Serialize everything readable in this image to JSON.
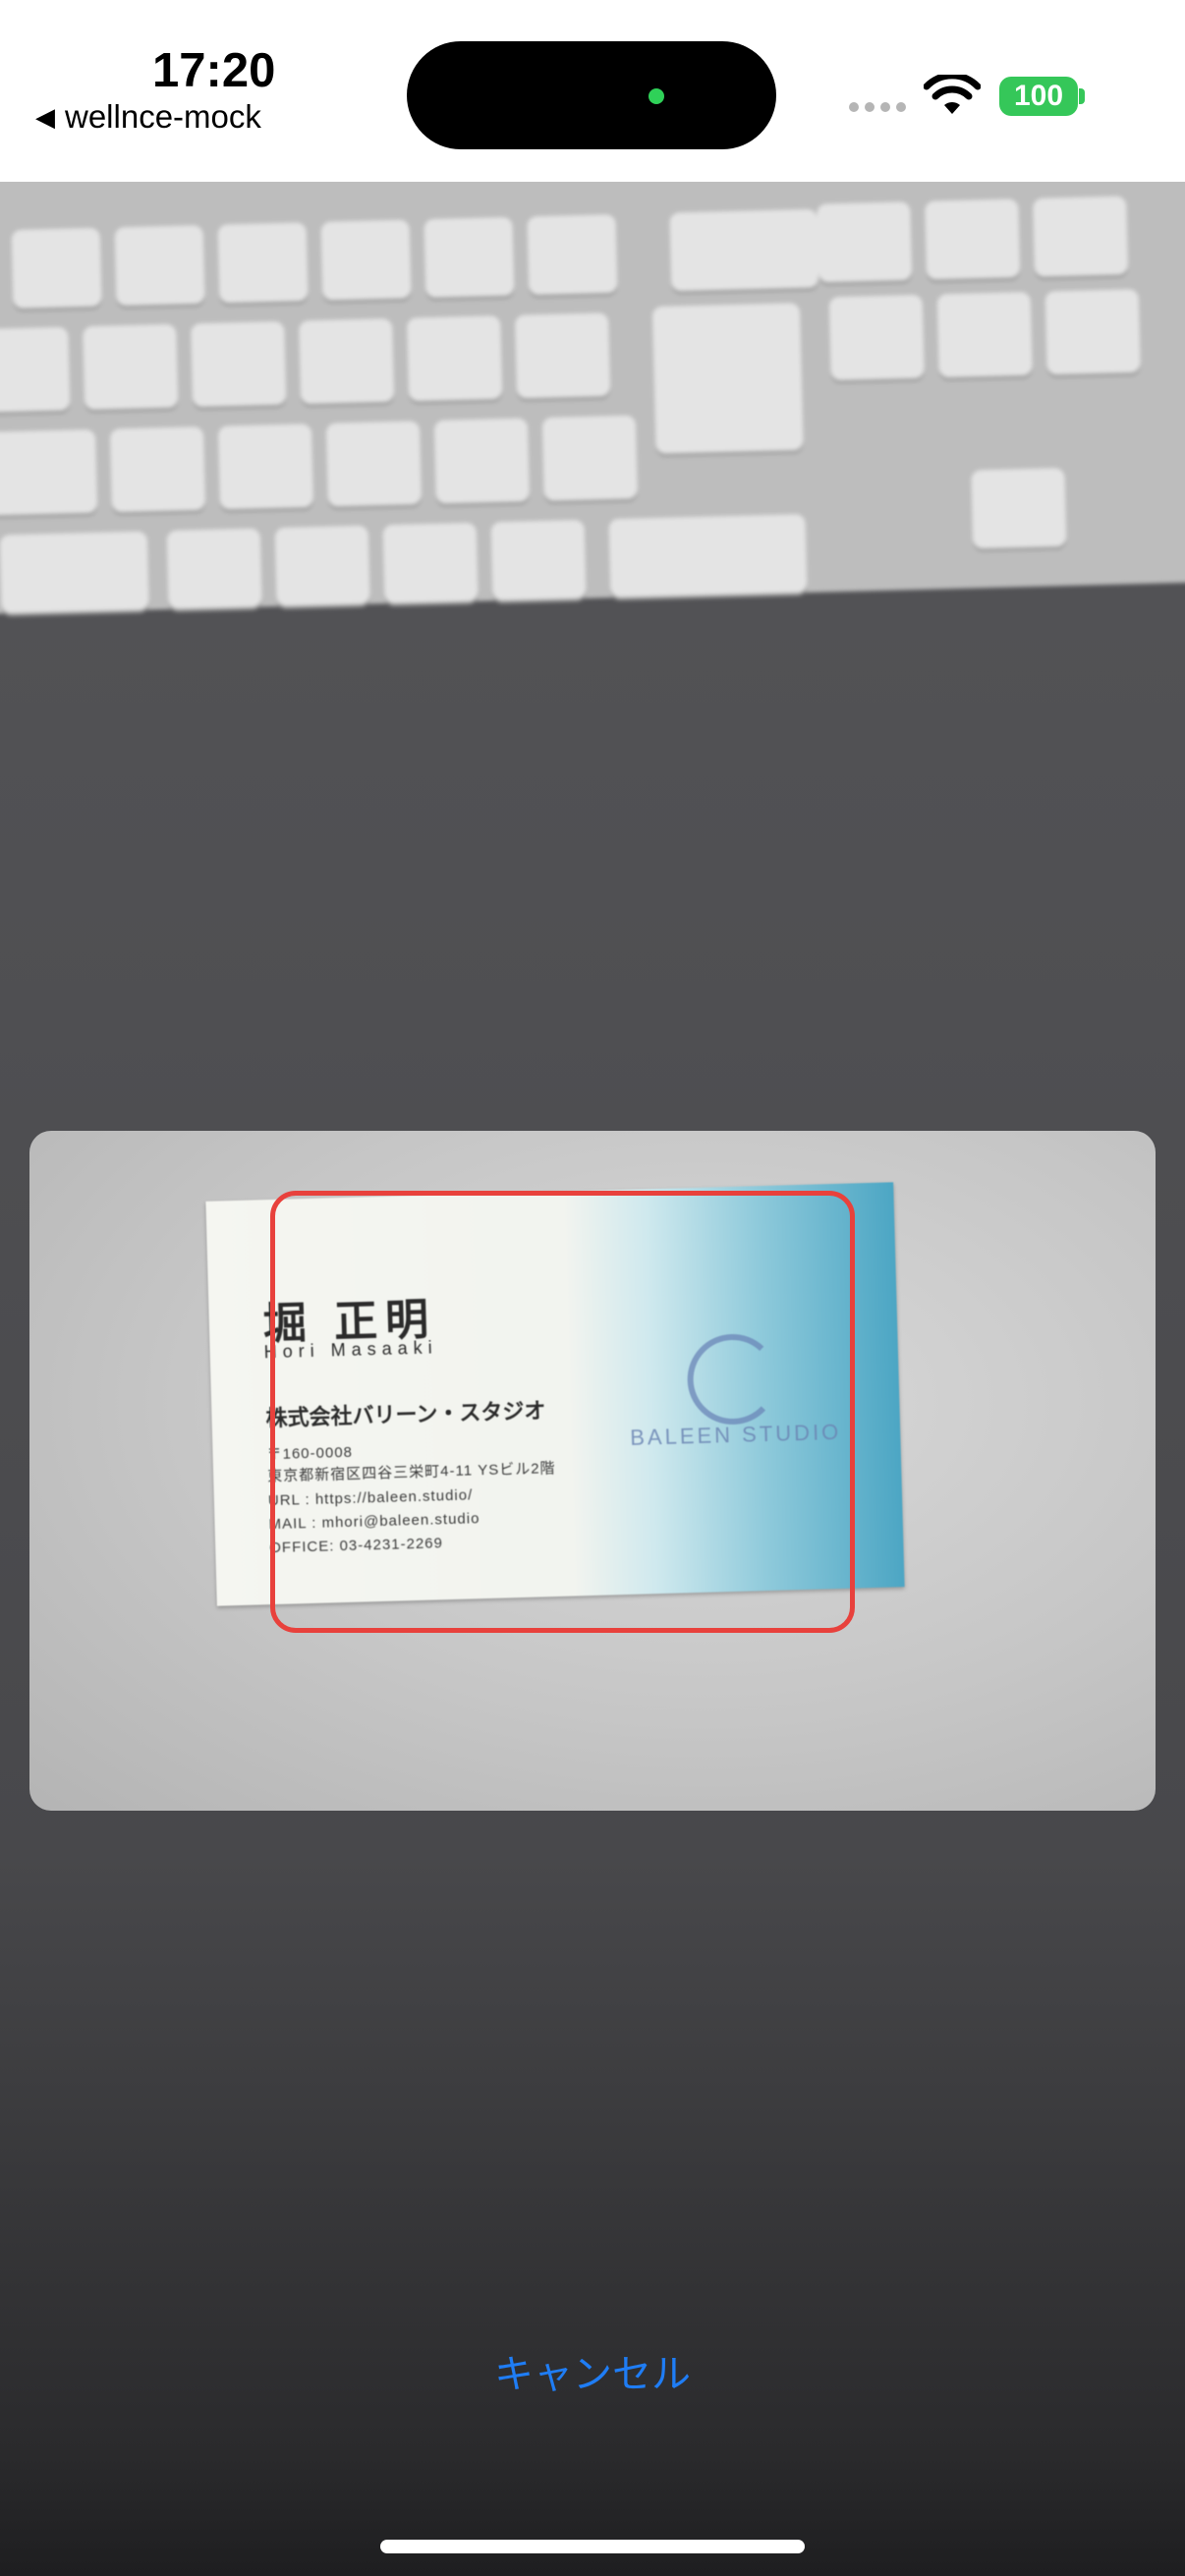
{
  "status_bar": {
    "time": "17:20",
    "back_app": "wellnce-mock",
    "battery": "100"
  },
  "card": {
    "name_jp": "堀 正明",
    "name_en": "Hori Masaaki",
    "company": "株式会社バリーン・スタジオ",
    "postal": "〒160-0008",
    "address": "東京都新宿区四谷三栄町4-11 YSビル2階",
    "url": "URL  : https://baleen.studio/",
    "mail": "MAIL : mhori@baleen.studio",
    "office": "OFFICE: 03-4231-2269",
    "logo": "BALEEN STUDIO"
  },
  "actions": {
    "cancel_label": "キャンセル"
  },
  "colors": {
    "accent": "#1f7df5",
    "detect_frame": "#e8413c",
    "battery": "#35c759"
  }
}
